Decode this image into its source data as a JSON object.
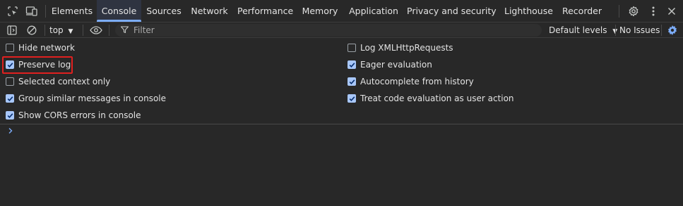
{
  "tabs": [
    {
      "label": "Elements"
    },
    {
      "label": "Console"
    },
    {
      "label": "Sources"
    },
    {
      "label": "Network"
    },
    {
      "label": "Performance"
    },
    {
      "label": "Memory"
    },
    {
      "label": "Application"
    },
    {
      "label": "Privacy and security"
    },
    {
      "label": "Lighthouse"
    },
    {
      "label": "Recorder"
    }
  ],
  "active_tab": "Console",
  "toolbar": {
    "context": "top",
    "filter_placeholder": "Filter",
    "levels": "Default levels",
    "issues": "No Issues"
  },
  "settings": {
    "left": [
      {
        "label": "Hide network",
        "checked": false
      },
      {
        "label": "Preserve log",
        "checked": true
      },
      {
        "label": "Selected context only",
        "checked": false
      },
      {
        "label": "Group similar messages in console",
        "checked": true
      },
      {
        "label": "Show CORS errors in console",
        "checked": true
      }
    ],
    "right": [
      {
        "label": "Log XMLHttpRequests",
        "checked": false
      },
      {
        "label": "Eager evaluation",
        "checked": true
      },
      {
        "label": "Autocomplete from history",
        "checked": true
      },
      {
        "label": "Treat code evaluation as user action",
        "checked": true
      }
    ]
  },
  "colors": {
    "background": "#282828",
    "accent": "#7cacf8",
    "checkbox_on": "#a8c7fa",
    "highlight": "#e0201f"
  }
}
